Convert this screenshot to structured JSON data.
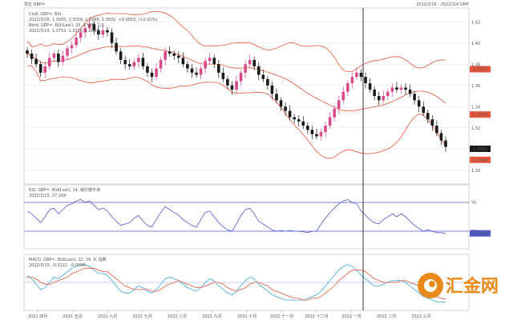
{
  "window": {
    "top_left": "周五 GBP=",
    "top_right": "2022/3/16 - 2022/3/4 GMT"
  },
  "colors": {
    "price": "#1a1a1a",
    "price_up": "#d84a8c",
    "bollinger": "#e8553b",
    "bollinger_mid": "#e8553b",
    "rsi": "#5058c8",
    "rsi_level": "#5058c8",
    "macd": "#3aa7dc",
    "signal": "#e8553b",
    "cursor": "#333333",
    "logo": "#e8891a"
  },
  "chart_data": [
    {
      "type": "candlestick",
      "panel": "price",
      "legend": [
        "Cndl, GBP=, Bid",
        "2022/3/15, 1.3005, 1.3009, 1.2998, 1.3002, +0.0003, (+0.02%)",
        "Bbrd, GBP=, Bid(Last), 20, 2 标准, 2.0",
        "2022/3/15, 1.3753, 1.3325, 1.2898"
      ],
      "y_ticks": [
        "1.42",
        "1.40",
        "1.38",
        "1.36",
        "1.34",
        "1.32",
        "1.30",
        "1.28"
      ],
      "ylim": [
        1.27,
        1.43
      ],
      "right_labels": [
        {
          "text": "1.3753",
          "value": 1.3753,
          "color": "#e8553b"
        },
        {
          "text": "1.3325",
          "value": 1.3325,
          "color": "#e8553b"
        },
        {
          "text": "1.3002",
          "value": 1.3002,
          "color": "#1a1a1a"
        },
        {
          "text": "1.2898",
          "value": 1.2898,
          "color": "#e8553b"
        }
      ],
      "close": [
        1.39,
        1.385,
        1.38,
        1.372,
        1.378,
        1.386,
        1.39,
        1.382,
        1.388,
        1.395,
        1.398,
        1.405,
        1.41,
        1.414,
        1.418,
        1.412,
        1.408,
        1.412,
        1.41,
        1.4,
        1.392,
        1.384,
        1.38,
        1.378,
        1.382,
        1.386,
        1.378,
        1.372,
        1.368,
        1.376,
        1.384,
        1.392,
        1.39,
        1.388,
        1.386,
        1.38,
        1.376,
        1.372,
        1.37,
        1.376,
        1.383,
        1.386,
        1.38,
        1.372,
        1.366,
        1.36,
        1.356,
        1.364,
        1.372,
        1.38,
        1.384,
        1.378,
        1.37,
        1.366,
        1.36,
        1.352,
        1.346,
        1.34,
        1.336,
        1.33,
        1.328,
        1.326,
        1.322,
        1.318,
        1.314,
        1.312,
        1.316,
        1.322,
        1.33,
        1.338,
        1.346,
        1.354,
        1.362,
        1.368,
        1.372,
        1.368,
        1.362,
        1.356,
        1.35,
        1.346,
        1.35,
        1.354,
        1.358,
        1.356,
        1.358,
        1.356,
        1.352,
        1.346,
        1.34,
        1.334,
        1.328,
        1.322,
        1.315,
        1.308,
        1.302
      ]
    },
    {
      "type": "line",
      "panel": "rsi",
      "legend": [
        "RSI, GBP=, Bid(Last), 14, 威尔德平滑",
        "2022/3/15, 27.164"
      ],
      "levels": [
        70,
        30
      ],
      "level_labels": [
        "70",
        "30"
      ],
      "last_label": "27.164",
      "ylim": [
        10,
        90
      ],
      "values": [
        58,
        54,
        48,
        42,
        50,
        60,
        62,
        54,
        60,
        66,
        68,
        72,
        74,
        70,
        72,
        66,
        60,
        62,
        58,
        50,
        44,
        38,
        40,
        42,
        48,
        52,
        44,
        38,
        36,
        46,
        56,
        64,
        60,
        56,
        52,
        46,
        42,
        38,
        36,
        46,
        56,
        58,
        50,
        42,
        36,
        32,
        30,
        40,
        52,
        60,
        62,
        54,
        44,
        40,
        36,
        32,
        30,
        31,
        30,
        31,
        30,
        30,
        29,
        28,
        30,
        30,
        40,
        48,
        56,
        62,
        68,
        72,
        74,
        70,
        68,
        58,
        52,
        46,
        42,
        40,
        46,
        50,
        54,
        50,
        54,
        50,
        44,
        38,
        34,
        30,
        32,
        30,
        28,
        28,
        27
      ]
    },
    {
      "type": "line",
      "panel": "macd",
      "legend": [
        "MACD, GBP=, Bid(Last), 12, 26, 9, 指数",
        "2022/3/15, -0.0112, -0.0094"
      ],
      "ylim": [
        -0.014,
        0.014
      ],
      "series": [
        {
          "name": "MACD",
          "values": [
            0.004,
            0.002,
            -0.001,
            -0.004,
            -0.003,
            0.0,
            0.003,
            0.002,
            0.004,
            0.006,
            0.008,
            0.009,
            0.01,
            0.01,
            0.009,
            0.007,
            0.005,
            0.005,
            0.004,
            0.001,
            -0.002,
            -0.005,
            -0.006,
            -0.006,
            -0.004,
            -0.002,
            -0.003,
            -0.005,
            -0.006,
            -0.004,
            -0.001,
            0.002,
            0.003,
            0.002,
            0.001,
            -0.001,
            -0.003,
            -0.004,
            -0.005,
            -0.003,
            0.0,
            0.002,
            0.001,
            -0.002,
            -0.004,
            -0.006,
            -0.007,
            -0.005,
            -0.002,
            0.001,
            0.003,
            0.002,
            -0.001,
            -0.003,
            -0.005,
            -0.007,
            -0.008,
            -0.009,
            -0.01,
            -0.01,
            -0.01,
            -0.01,
            -0.01,
            -0.009,
            -0.008,
            -0.007,
            -0.005,
            -0.002,
            0.001,
            0.004,
            0.007,
            0.009,
            0.01,
            0.009,
            0.007,
            0.004,
            0.002,
            0.0,
            -0.002,
            -0.002,
            -0.001,
            0.0,
            0.001,
            0.001,
            0.001,
            0.0,
            -0.002,
            -0.004,
            -0.006,
            -0.008,
            -0.009,
            -0.01,
            -0.011,
            -0.011,
            -0.0112
          ]
        },
        {
          "name": "Signal",
          "values": [
            0.003,
            0.003,
            0.002,
            0.0,
            -0.001,
            -0.001,
            0.0,
            0.001,
            0.002,
            0.003,
            0.005,
            0.006,
            0.007,
            0.008,
            0.008,
            0.008,
            0.007,
            0.006,
            0.006,
            0.004,
            0.002,
            0.0,
            -0.002,
            -0.003,
            -0.004,
            -0.004,
            -0.004,
            -0.004,
            -0.005,
            -0.005,
            -0.004,
            -0.002,
            -0.001,
            0.0,
            0.001,
            0.0,
            -0.001,
            -0.002,
            -0.003,
            -0.003,
            -0.002,
            -0.001,
            0.0,
            0.0,
            -0.001,
            -0.003,
            -0.004,
            -0.005,
            -0.004,
            -0.003,
            -0.001,
            0.0,
            0.0,
            -0.001,
            -0.002,
            -0.004,
            -0.005,
            -0.006,
            -0.007,
            -0.008,
            -0.009,
            -0.009,
            -0.01,
            -0.01,
            -0.009,
            -0.009,
            -0.008,
            -0.006,
            -0.004,
            -0.002,
            0.001,
            0.003,
            0.005,
            0.007,
            0.007,
            0.007,
            0.006,
            0.004,
            0.002,
            0.001,
            0.0,
            0.0,
            0.0,
            0.0,
            0.001,
            0.001,
            0.0,
            -0.001,
            -0.002,
            -0.004,
            -0.005,
            -0.006,
            -0.008,
            -0.009,
            -0.0094
          ]
        }
      ]
    }
  ],
  "time_axis": {
    "labels": [
      "2021 四月",
      "2021 五月",
      "2021 六月",
      "2021 七月",
      "2021 八月",
      "2021 九月",
      "2021 十月",
      "2021 十一月",
      "2021 十二月",
      "2022 一月",
      "2022 二月",
      "2022 三月"
    ]
  },
  "watermark": {
    "text": "汇金网"
  }
}
